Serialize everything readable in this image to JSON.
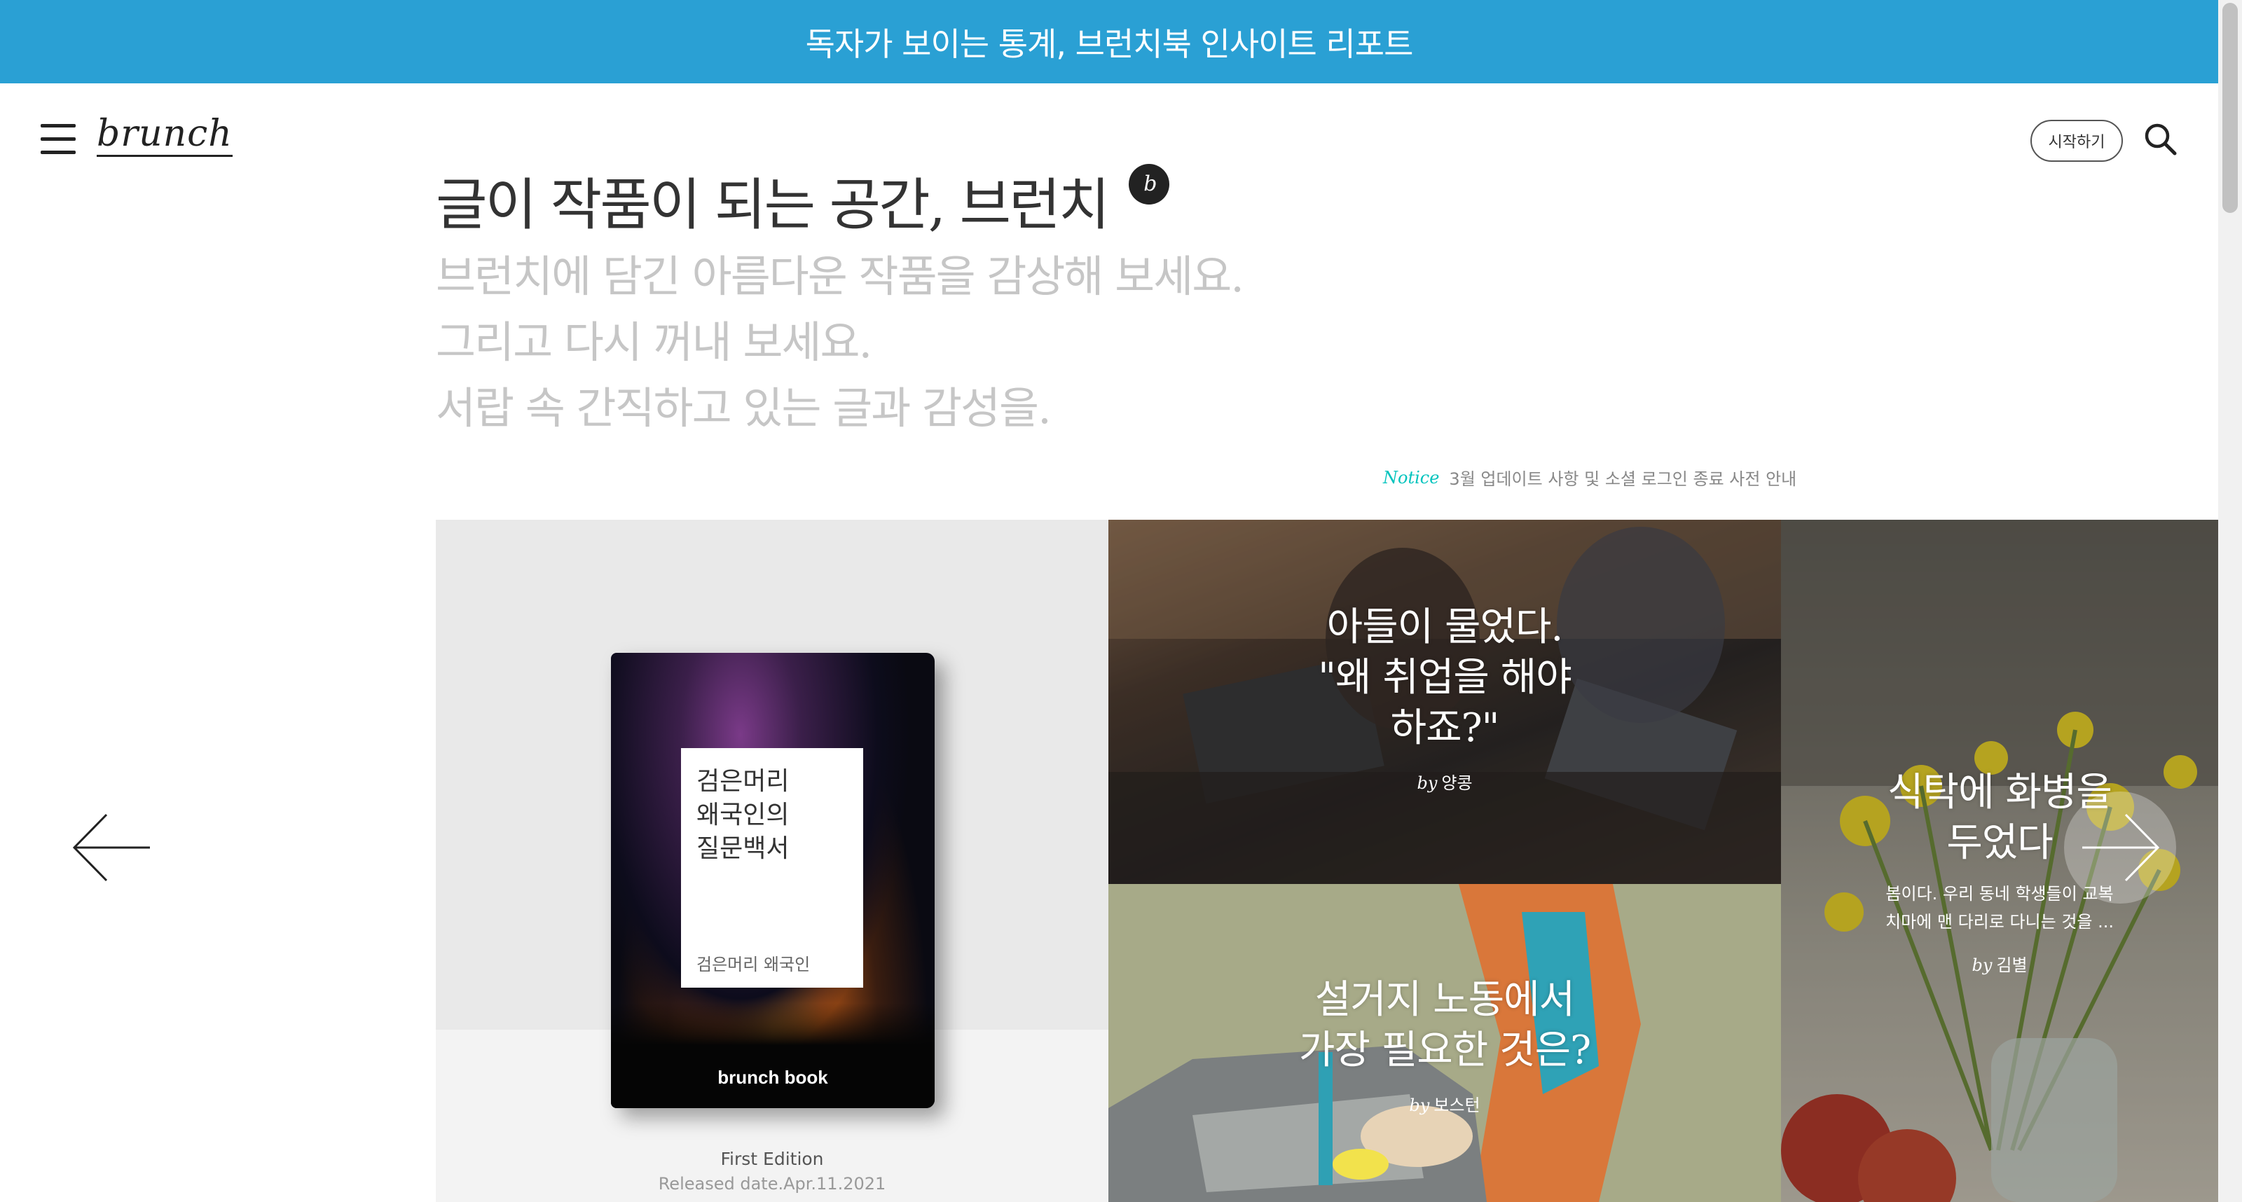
{
  "banner": {
    "text": "독자가 보이는 통계, 브런치북 인사이트 리포트"
  },
  "header": {
    "logo": "brunch",
    "start_label": "시작하기",
    "icons": {
      "menu": "hamburger-menu-icon",
      "search": "search-icon"
    }
  },
  "intro": {
    "title": "글이 작품이 되는 공간, 브런치",
    "lines": [
      "브런치에 담긴 아름다운 작품을 감상해 보세요.",
      "그리고 다시 꺼내 보세요.",
      "서랍 속 간직하고 있는 글과 감성을."
    ]
  },
  "notice": {
    "tag": "Notice",
    "text": "3월 업데이트 사항 및 소셜 로그인 종료 사전 안내"
  },
  "book": {
    "title": "검은머리\n왜국인의\n질문백서",
    "author": "검은머리 왜국인",
    "brand": "brunch book",
    "edition": "First Edition",
    "release": "Released date.Apr.11.2021"
  },
  "cards": [
    {
      "title": "아들이 물었다.\n\"왜 취업을 해야\n하죠?\"",
      "by": "by",
      "author": "양콩"
    },
    {
      "title": "설거지 노동에서\n가장 필요한 것은?",
      "by": "by",
      "author": "보스턴"
    },
    {
      "title": "식탁에 화병을\n두었다",
      "desc": "봄이다. 우리 동네 학생들이 교복\n치마에 맨 다리로 다니는 것을 ...",
      "by": "by",
      "author": "김별"
    }
  ],
  "colors": {
    "banner": "#2aa0d4",
    "notice_tag": "#00c3bd",
    "subtitle": "#c6c6c6"
  }
}
